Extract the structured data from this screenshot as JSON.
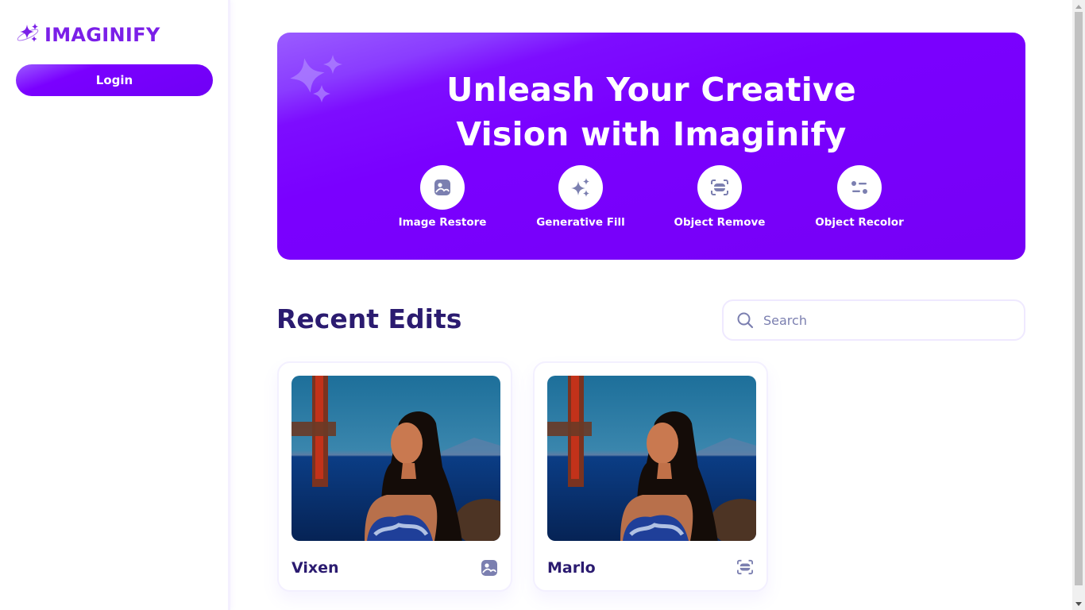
{
  "app": {
    "logo_text": "IMAGINIFY",
    "brand_color": "#7b1fe8"
  },
  "sidebar": {
    "login_label": "Login"
  },
  "banner": {
    "title_line1": "Unleash Your Creative",
    "title_line2": "Vision with Imaginify",
    "features": [
      {
        "label": "Image Restore",
        "icon": "image-icon"
      },
      {
        "label": "Generative Fill",
        "icon": "stars-icon"
      },
      {
        "label": "Object Remove",
        "icon": "scan-icon"
      },
      {
        "label": "Object Recolor",
        "icon": "filter-icon"
      }
    ]
  },
  "recent": {
    "title": "Recent Edits",
    "search_placeholder": "Search",
    "search_value": "",
    "items": [
      {
        "title": "Vixen",
        "type_icon": "image-icon"
      },
      {
        "title": "Marlo",
        "type_icon": "scan-icon"
      }
    ]
  }
}
